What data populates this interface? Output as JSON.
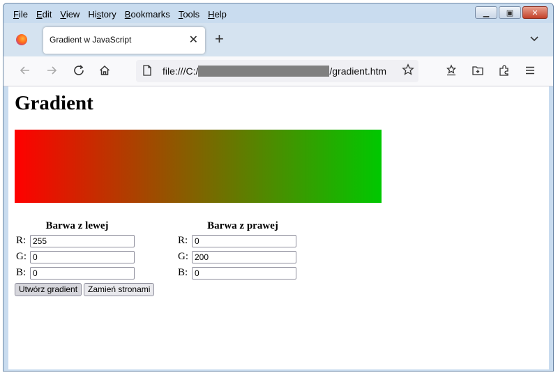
{
  "menu": [
    "File",
    "Edit",
    "View",
    "History",
    "Bookmarks",
    "Tools",
    "Help"
  ],
  "menu_access": [
    "F",
    "E",
    "V",
    "s",
    "B",
    "T",
    "H"
  ],
  "tab": {
    "title": "Gradient w JavaScript",
    "close": "✕"
  },
  "newtab": "+",
  "tablist": "⌄",
  "url": {
    "prefix": "file:///C:/",
    "suffix": "/gradient.htm"
  },
  "page": {
    "title": "Gradient"
  },
  "gradient": {
    "left_color": "#ff0000",
    "right_color": "#00c800"
  },
  "left": {
    "heading": "Barwa z lewej",
    "labels": [
      "R:",
      "G:",
      "B:"
    ],
    "values": [
      "255",
      "0",
      "0"
    ]
  },
  "right": {
    "heading": "Barwa z prawej",
    "labels": [
      "R:",
      "G:",
      "B:"
    ],
    "values": [
      "0",
      "200",
      "0"
    ]
  },
  "buttons": {
    "create": "Utwórz gradient",
    "swap": "Zamień stronami"
  }
}
